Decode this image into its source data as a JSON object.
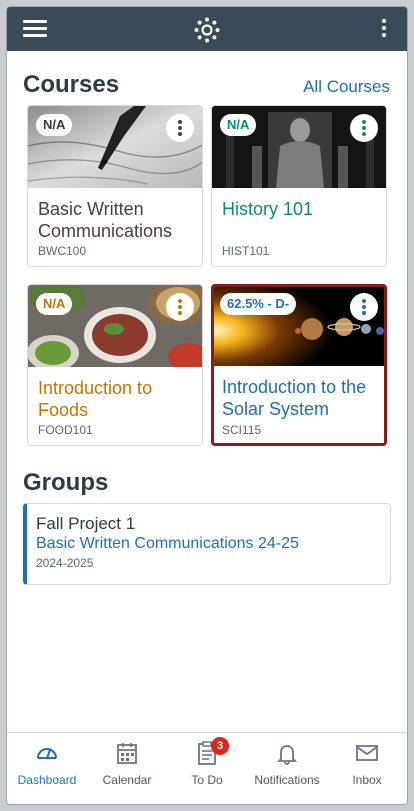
{
  "courses": {
    "title": "Courses",
    "all_link": "All Courses",
    "items": [
      {
        "name": "Basic Written Communications",
        "code": "BWC100",
        "grade": "N/A",
        "color": "#4f3a4e"
      },
      {
        "name": "History 101",
        "code": "HIST101",
        "grade": "N/A",
        "color": "#0d8a77"
      },
      {
        "name": "Introduction to Foods",
        "code": "FOOD101",
        "grade": "N/A",
        "color": "#c57300"
      },
      {
        "name": "Introduction to the Solar System",
        "code": "SCI115",
        "grade": "62.5% - D-",
        "color": "#1f6fb5"
      }
    ]
  },
  "groups": {
    "title": "Groups",
    "items": [
      {
        "name": "Fall Project 1",
        "course": "Basic Written Communications 24-25",
        "term": "2024-2025"
      }
    ]
  },
  "tabbar": {
    "items": [
      {
        "label": "Dashboard",
        "icon": "dashboard-icon",
        "active": true
      },
      {
        "label": "Calendar",
        "icon": "calendar-icon"
      },
      {
        "label": "To Do",
        "icon": "todo-icon",
        "badge": "3"
      },
      {
        "label": "Notifications",
        "icon": "bell-icon"
      },
      {
        "label": "Inbox",
        "icon": "inbox-icon"
      }
    ]
  },
  "colors": {
    "header": "#394b58",
    "accent": "#1f6fb5",
    "selected_border": "#8b1a1a",
    "badge": "#e0241b"
  }
}
